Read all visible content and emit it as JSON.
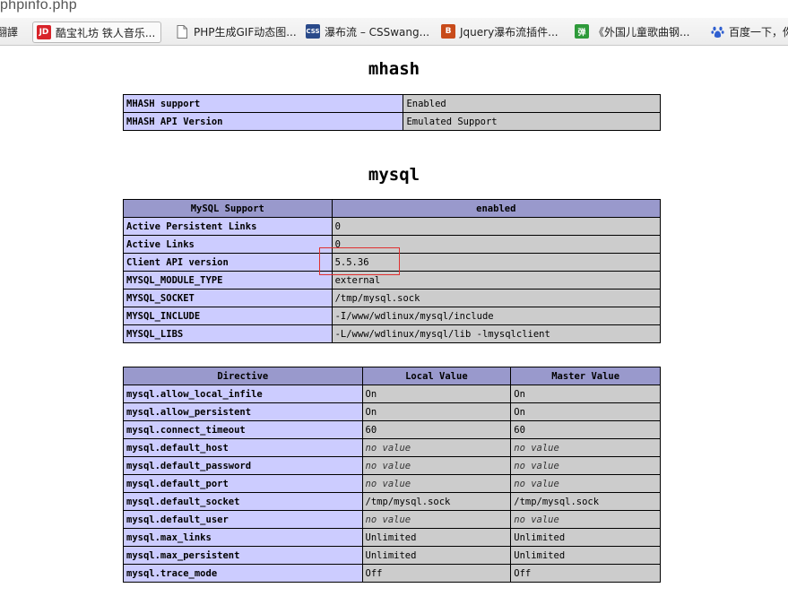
{
  "browser": {
    "url_fragment": "phpinfo.php",
    "bookmarks": [
      {
        "label": "翻譯",
        "icon": "translate-icon"
      },
      {
        "label": "酷宝礼坊 铁人音乐...",
        "icon": "jd-icon",
        "icon_text": "JD",
        "icon_color": "#d8232a"
      },
      {
        "label": "PHP生成GIF动态图...",
        "icon": "page-icon"
      },
      {
        "label": "瀑布流 – CSSwang...",
        "icon": "css-icon",
        "icon_text": "CSS",
        "icon_color": "#2a4a8a"
      },
      {
        "label": "Jquery瀑布流插件...",
        "icon": "b-icon",
        "icon_text": "B",
        "icon_color": "#c84b1a"
      },
      {
        "label": "《外国儿童歌曲钢...",
        "icon": "dan-icon",
        "icon_text": "弹",
        "icon_color": "#2e9a3a"
      },
      {
        "label": "百度一下，你",
        "icon": "baidu-paw-icon"
      }
    ]
  },
  "sections": {
    "mhash": {
      "title": "mhash",
      "rows": [
        {
          "name": "MHASH support",
          "value": "Enabled"
        },
        {
          "name": "MHASH API Version",
          "value": "Emulated Support"
        }
      ]
    },
    "mysql": {
      "title": "mysql",
      "header": {
        "left": "MySQL Support",
        "right": "enabled"
      },
      "rows": [
        {
          "name": "Active Persistent Links",
          "value": "0"
        },
        {
          "name": "Active Links",
          "value": "0"
        },
        {
          "name": "Client API version",
          "value": "5.5.36"
        },
        {
          "name": "MYSQL_MODULE_TYPE",
          "value": "external"
        },
        {
          "name": "MYSQL_SOCKET",
          "value": "/tmp/mysql.sock"
        },
        {
          "name": "MYSQL_INCLUDE",
          "value": "-I/www/wdlinux/mysql/include"
        },
        {
          "name": "MYSQL_LIBS",
          "value": "-L/www/wdlinux/mysql/lib -lmysqlclient"
        }
      ]
    },
    "directives": {
      "headers": [
        "Directive",
        "Local Value",
        "Master Value"
      ],
      "rows": [
        {
          "name": "mysql.allow_local_infile",
          "local": "On",
          "master": "On"
        },
        {
          "name": "mysql.allow_persistent",
          "local": "On",
          "master": "On"
        },
        {
          "name": "mysql.connect_timeout",
          "local": "60",
          "master": "60"
        },
        {
          "name": "mysql.default_host",
          "local": "no value",
          "master": "no value"
        },
        {
          "name": "mysql.default_password",
          "local": "no value",
          "master": "no value"
        },
        {
          "name": "mysql.default_port",
          "local": "no value",
          "master": "no value"
        },
        {
          "name": "mysql.default_socket",
          "local": "/tmp/mysql.sock",
          "master": "/tmp/mysql.sock"
        },
        {
          "name": "mysql.default_user",
          "local": "no value",
          "master": "no value"
        },
        {
          "name": "mysql.max_links",
          "local": "Unlimited",
          "master": "Unlimited"
        },
        {
          "name": "mysql.max_persistent",
          "local": "Unlimited",
          "master": "Unlimited"
        },
        {
          "name": "mysql.trace_mode",
          "local": "Off",
          "master": "Off"
        }
      ]
    }
  },
  "colors": {
    "header_bg": "#9999cc",
    "label_bg": "#ccccff",
    "value_bg": "#cccccc",
    "highlight_box": "#e03030"
  }
}
